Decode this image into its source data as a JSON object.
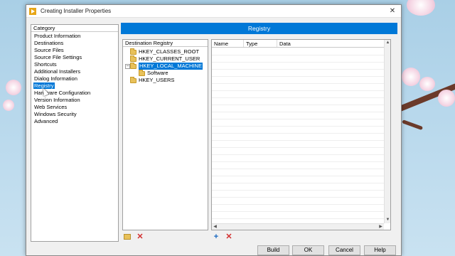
{
  "window": {
    "title": "Creating Installer Properties",
    "close_glyph": "✕"
  },
  "category": {
    "header": "Category",
    "items": [
      {
        "label": "Product Information"
      },
      {
        "label": "Destinations"
      },
      {
        "label": "Source Files"
      },
      {
        "label": "Source File Settings"
      },
      {
        "label": "Shortcuts"
      },
      {
        "label": "Additional Installers"
      },
      {
        "label": "Dialog Information"
      },
      {
        "label": "Registry",
        "selected": true
      },
      {
        "label": "Hardware Configuration"
      },
      {
        "label": "Version Information"
      },
      {
        "label": "Web Services"
      },
      {
        "label": "Windows Security"
      },
      {
        "label": "Advanced"
      }
    ]
  },
  "banner": {
    "title": "Registry"
  },
  "tree": {
    "header": "Destination Registry",
    "nodes": [
      {
        "label": "HKEY_CLASSES_ROOT"
      },
      {
        "label": "HKEY_CURRENT_USER"
      },
      {
        "label": "HKEY_LOCAL_MACHINE",
        "selected": true,
        "expanded": true,
        "expander": "−"
      },
      {
        "label": "Software",
        "child": true
      },
      {
        "label": "HKEY_USERS"
      }
    ]
  },
  "values": {
    "columns": [
      "Name",
      "Type",
      "Data"
    ]
  },
  "buttons": {
    "new_folder_icon": "folder-plus-icon",
    "delete_key_glyph": "✕",
    "add_value_glyph": "+",
    "delete_value_glyph": "✕",
    "build": "Build",
    "ok": "OK",
    "cancel": "Cancel",
    "help": "Help"
  },
  "colors": {
    "accent": "#0078d7",
    "delete": "#d32f2f",
    "add": "#1565c0"
  }
}
